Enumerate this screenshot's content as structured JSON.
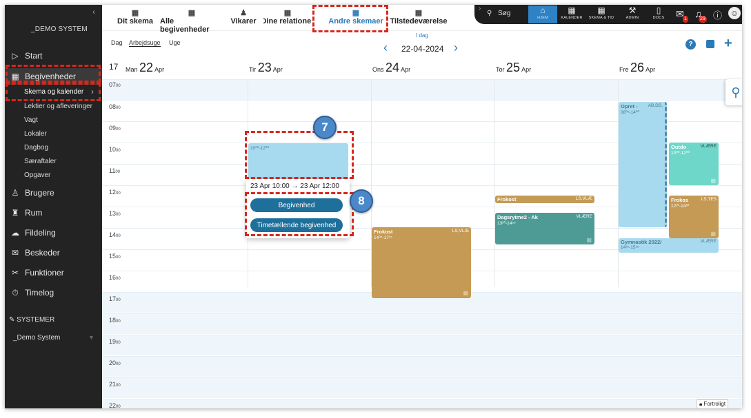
{
  "sidebar": {
    "brand": "_DEMO SYSTEM",
    "start": "Start",
    "begivenheder": "Begivenheder",
    "sub": [
      "Skema og kalender",
      "Lektier og afleveringer",
      "Vagt",
      "Lokaler",
      "Dagbog",
      "Særaftaler",
      "Opgaver"
    ],
    "brugere": "Brugere",
    "rum": "Rum",
    "fildeling": "Fildeling",
    "beskeder": "Beskeder",
    "funktioner": "Funktioner",
    "timelog": "Timelog",
    "systemer_header": "SYSTEMER",
    "system_name": "_Demo System"
  },
  "topnav": {
    "tabs": [
      "Dit skema",
      "Alle begivenheder",
      "Vikarer",
      "Dine relationer",
      "Andre skemaer",
      "Tilstedeværelse"
    ],
    "search": "Søg",
    "buttons": [
      "HJEM",
      "KALENDER",
      "SKEMA & TID",
      "ADMIN",
      "DOCS"
    ],
    "mail_badge": "1",
    "bell_badge": "29"
  },
  "view": {
    "modes": [
      "Dag",
      "Arbejdsuge",
      "Uge"
    ],
    "today": "I dag",
    "date": "22-04-2024"
  },
  "calendar": {
    "week": "17",
    "days": [
      {
        "name": "Man",
        "num": "22",
        "mon": "Apr"
      },
      {
        "name": "Tir",
        "num": "23",
        "mon": "Apr"
      },
      {
        "name": "Ons",
        "num": "24",
        "mon": "Apr"
      },
      {
        "name": "Tor",
        "num": "25",
        "mon": "Apr"
      },
      {
        "name": "Fre",
        "num": "26",
        "mon": "Apr"
      }
    ],
    "hours": [
      "07",
      "08",
      "09",
      "10",
      "11",
      "12",
      "13",
      "14",
      "15",
      "16",
      "17",
      "18",
      "19",
      "20",
      "21",
      "22"
    ],
    "hour_suffix": "00",
    "events": {
      "selection": {
        "time": "10⁰⁰-12⁰⁰"
      },
      "frokost_wed": {
        "title": "Frokost",
        "room": "LS,VLÆ",
        "time": "14⁰⁵-17²⁵"
      },
      "frokost_thu": {
        "title": "Frokost",
        "room": "LS,VLÆ"
      },
      "dagsrytme": {
        "title": "Dagsrytme2 - Ak",
        "room": "VLÆRE",
        "time": "13²⁰-14⁵⁵"
      },
      "opret": {
        "title": "Opret -",
        "room": "AB,DB,",
        "time": "08⁰⁵-14⁰⁰"
      },
      "outdoor": {
        "title": "Outdo",
        "room": "VLÆRE",
        "time": "10⁰⁰-12⁰⁰"
      },
      "frokost_fri": {
        "title": "Frokos",
        "room": "LS,TES",
        "time": "12³⁰-14³⁰"
      },
      "gymnastik": {
        "title": "Gymnastik 2022/",
        "room": "VLÆRE",
        "time": "14³⁵-15¹⁵"
      }
    },
    "popup": {
      "range": "23 Apr 10:00 → 23 Apr 12:00",
      "btn1": "Begivenhed",
      "btn2": "Timetællende begivenhed"
    }
  },
  "markers": {
    "m7": "7",
    "m8": "8"
  },
  "footer": {
    "fortroligt": "Fortroligt"
  }
}
